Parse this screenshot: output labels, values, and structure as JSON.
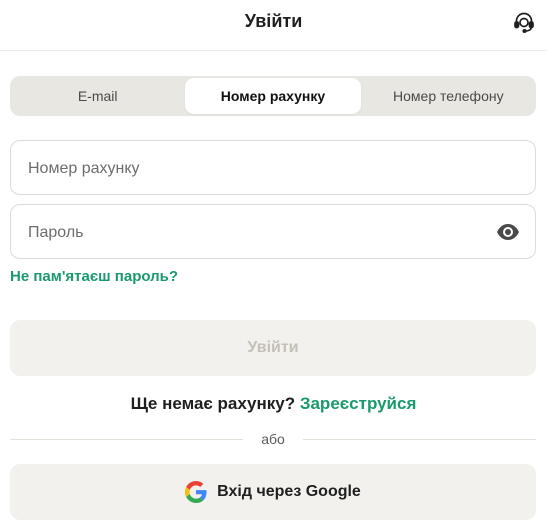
{
  "header": {
    "title": "Увійти",
    "support_icon": "headset-icon"
  },
  "tabs": [
    {
      "label": "E-mail",
      "active": false
    },
    {
      "label": "Номер рахунку",
      "active": true
    },
    {
      "label": "Номер телефону",
      "active": false
    }
  ],
  "form": {
    "account_placeholder": "Номер рахунку",
    "account_value": "",
    "password_placeholder": "Пароль",
    "password_value": "",
    "password_toggle_icon": "eye-icon",
    "forgot_password": "Не пам'ятаєш пароль?",
    "submit_label": "Увійти"
  },
  "register": {
    "question": "Ще немає рахунку?",
    "link": "Зареєструйся"
  },
  "divider": {
    "text": "або"
  },
  "google": {
    "icon": "google-icon",
    "label": "Вхід через Google"
  },
  "colors": {
    "accent": "#1a9a6c",
    "tab_bg": "#e9e7e2",
    "button_bg": "#f3f1ed",
    "disabled_text": "#c4c0b8"
  }
}
